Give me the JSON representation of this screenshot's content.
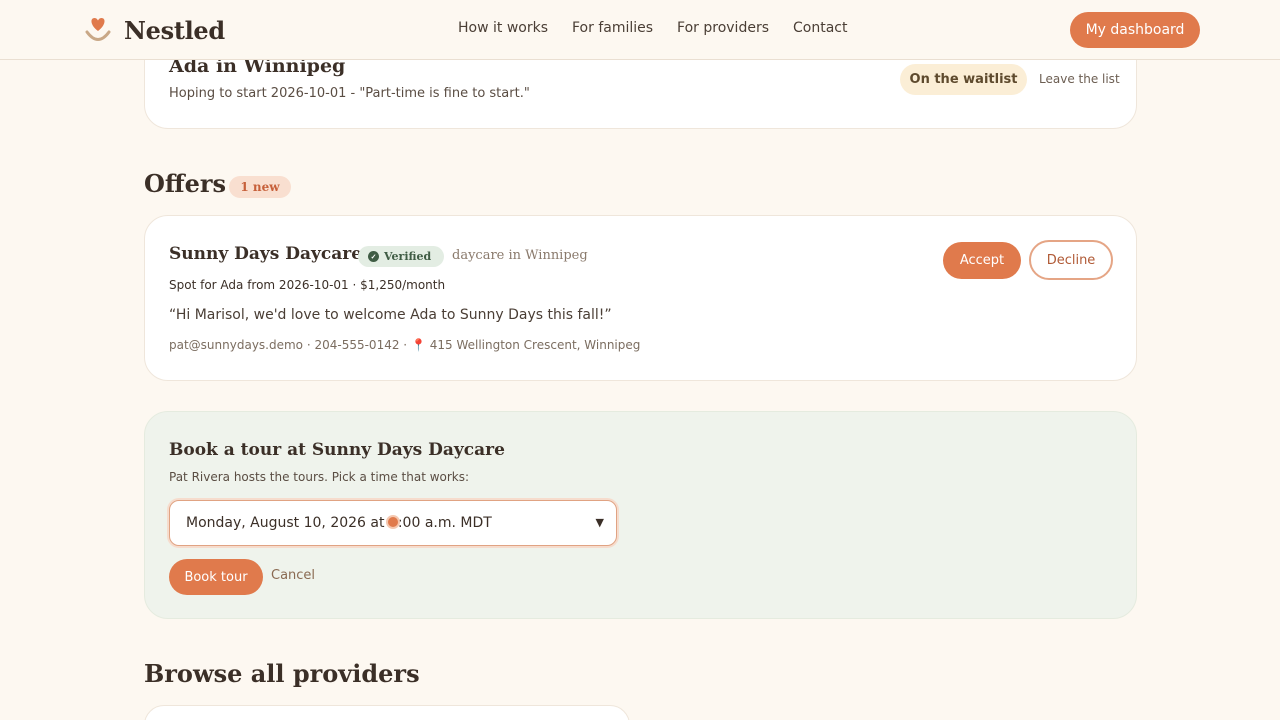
{
  "header": {
    "brand": "Nestled",
    "nav": [
      "How it works",
      "For families",
      "For providers",
      "Contact"
    ],
    "dashboard_label": "My dashboard"
  },
  "waitlist": {
    "title": "Ada in Winnipeg",
    "subtitle": "Hoping to start 2026-10-01 - \"Part-time is fine to start.\"",
    "status": "On the waitlist",
    "leave_label": "Leave the list"
  },
  "offers": {
    "heading": "Offers",
    "badge": "1 new",
    "items": [
      {
        "name": "Sunny Days Daycare",
        "verified_label": "Verified",
        "meta": "daycare in Winnipeg",
        "spot": "Spot for Ada from 2026-10-01 · $1,250/month",
        "message": "“Hi Marisol, we'd love to welcome Ada to Sunny Days this fall!”",
        "contact": "pat@sunnydays.demo · 204-555-0142 ·",
        "address": "415 Wellington Crescent, Winnipeg",
        "accept_label": "Accept",
        "decline_label": "Decline"
      }
    ]
  },
  "tour": {
    "title": "Book a tour at Sunny Days Daycare",
    "subtitle": "Pat Rivera hosts the tours. Pick a time that works:",
    "selected_time": "Monday, August 10, 2026 at 9:00 a.m. MDT",
    "book_label": "Book tour",
    "cancel_label": "Cancel"
  },
  "browse": {
    "heading": "Browse all providers"
  },
  "colors": {
    "accent": "#e07a4c",
    "background": "#fdf8f1",
    "tour_panel": "#eff3ec"
  }
}
